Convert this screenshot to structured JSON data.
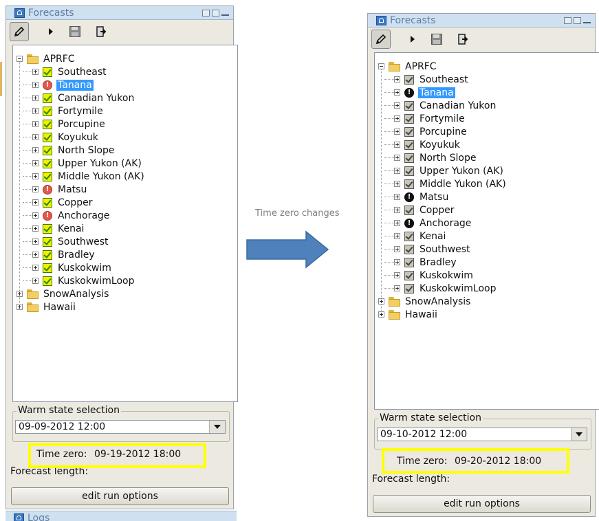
{
  "caption": "Time zero changes",
  "arrow_color": "#4f81bd",
  "highlight_color": "#ffff00",
  "selection_color": "#3399ff",
  "left_panel": {
    "title": "Forecasts",
    "tree": {
      "root": "APRFC",
      "children": [
        {
          "label": "Southeast",
          "status": "check"
        },
        {
          "label": "Tanana",
          "status": "warning",
          "selected": true
        },
        {
          "label": "Canadian Yukon",
          "status": "check"
        },
        {
          "label": "Fortymile",
          "status": "check"
        },
        {
          "label": "Porcupine",
          "status": "check"
        },
        {
          "label": "Koyukuk",
          "status": "check"
        },
        {
          "label": "North Slope",
          "status": "check"
        },
        {
          "label": "Upper Yukon (AK)",
          "status": "check"
        },
        {
          "label": "Middle Yukon (AK)",
          "status": "check"
        },
        {
          "label": "Matsu",
          "status": "warning"
        },
        {
          "label": "Copper",
          "status": "check"
        },
        {
          "label": "Anchorage",
          "status": "warning"
        },
        {
          "label": "Kenai",
          "status": "check"
        },
        {
          "label": "Southwest",
          "status": "check"
        },
        {
          "label": "Bradley",
          "status": "check"
        },
        {
          "label": "Kuskokwim",
          "status": "check"
        },
        {
          "label": "KuskokwimLoop",
          "status": "check"
        }
      ],
      "siblings": [
        "SnowAnalysis",
        "Hawaii"
      ]
    },
    "warm_state_label": "Warm state selection",
    "warm_state_value": "09-09-2012 12:00",
    "time_zero_label": "Time zero:",
    "time_zero_value": "09-19-2012 18:00",
    "forecast_length_label": "Forecast length:",
    "edit_button": "edit run options",
    "bottom_panel_title": "Logs"
  },
  "right_panel": {
    "title": "Forecasts",
    "tree": {
      "root": "APRFC",
      "children": [
        {
          "label": "Southeast",
          "status": "check"
        },
        {
          "label": "Tanana",
          "status": "warning",
          "selected": true
        },
        {
          "label": "Canadian Yukon",
          "status": "check"
        },
        {
          "label": "Fortymile",
          "status": "check"
        },
        {
          "label": "Porcupine",
          "status": "check"
        },
        {
          "label": "Koyukuk",
          "status": "check"
        },
        {
          "label": "North Slope",
          "status": "check"
        },
        {
          "label": "Upper Yukon (AK)",
          "status": "check"
        },
        {
          "label": "Middle Yukon (AK)",
          "status": "check"
        },
        {
          "label": "Matsu",
          "status": "warning"
        },
        {
          "label": "Copper",
          "status": "check"
        },
        {
          "label": "Anchorage",
          "status": "warning"
        },
        {
          "label": "Kenai",
          "status": "check"
        },
        {
          "label": "Southwest",
          "status": "check"
        },
        {
          "label": "Bradley",
          "status": "check"
        },
        {
          "label": "Kuskokwim",
          "status": "check"
        },
        {
          "label": "KuskokwimLoop",
          "status": "check"
        }
      ],
      "siblings": [
        "SnowAnalysis",
        "Hawaii"
      ]
    },
    "warm_state_label": "Warm state selection",
    "warm_state_value": "09-10-2012 12:00",
    "time_zero_label": "Time zero:",
    "time_zero_value": "09-20-2012 18:00",
    "forecast_length_label": "Forecast length:",
    "edit_button": "edit run options"
  }
}
